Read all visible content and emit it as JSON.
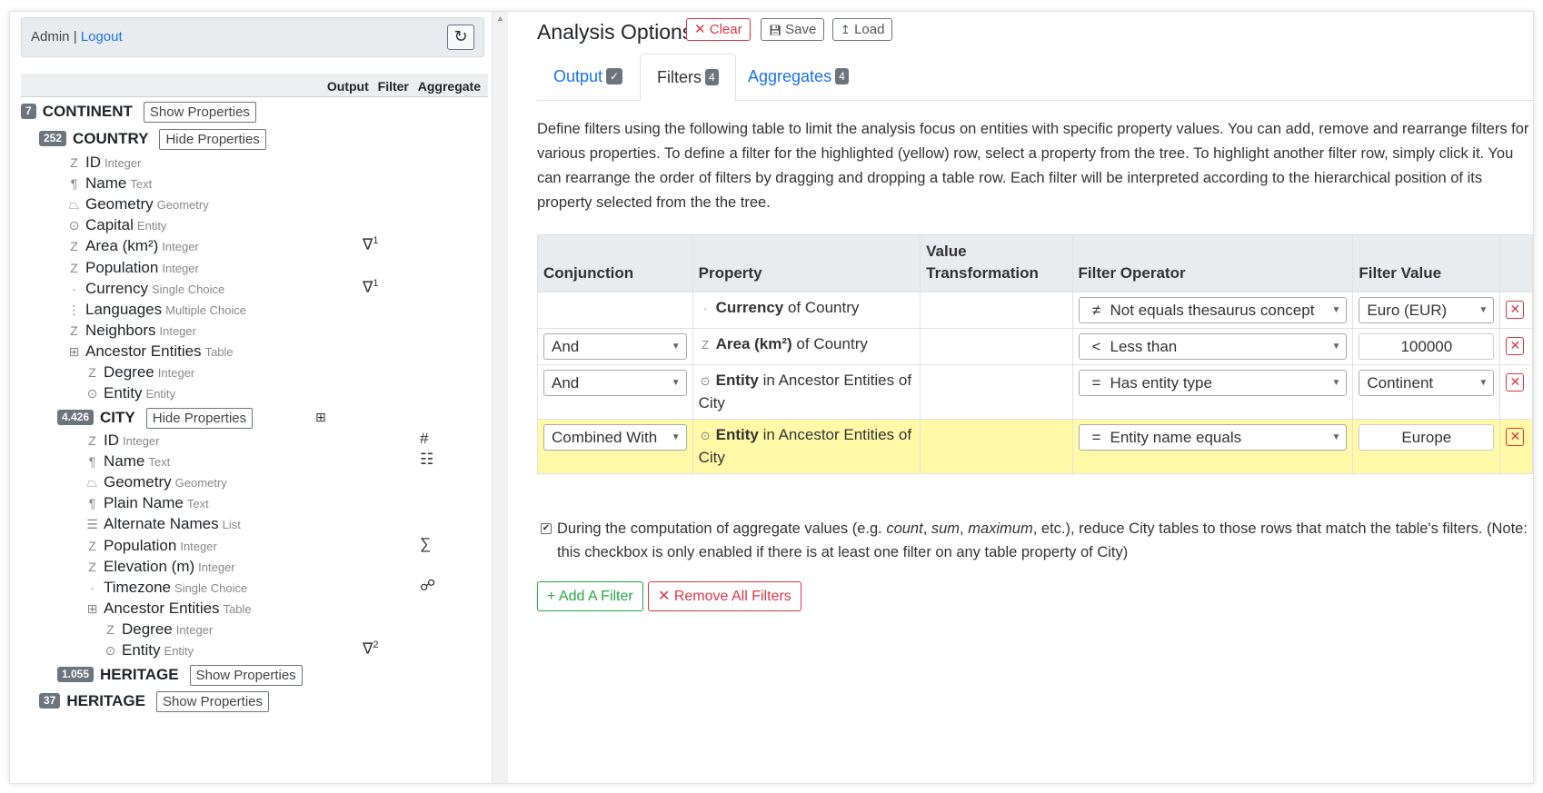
{
  "userbar": {
    "user": "Admin",
    "separator": "|",
    "logout": "Logout",
    "refresh_icon": "refresh-icon"
  },
  "columns": {
    "output": "Output",
    "filter": "Filter",
    "aggregate": "Aggregate"
  },
  "tree": {
    "continent": {
      "count": "7",
      "name": "CONTINENT",
      "button": "Show Properties"
    },
    "country": {
      "count": "252",
      "name": "COUNTRY",
      "button": "Hide Properties"
    },
    "country_props": [
      {
        "icon": "Z",
        "name": "ID",
        "type": "Integer"
      },
      {
        "icon": "¶",
        "name": "Name",
        "type": "Text"
      },
      {
        "icon": "⏢",
        "name": "Geometry",
        "type": "Geometry"
      },
      {
        "icon": "⊙",
        "name": "Capital",
        "type": "Entity"
      },
      {
        "icon": "Z",
        "name": "Area (km²)",
        "type": "Integer",
        "mark": "∇",
        "sup": "1"
      },
      {
        "icon": "Z",
        "name": "Population",
        "type": "Integer"
      },
      {
        "icon": "·",
        "name": "Currency",
        "type": "Single Choice",
        "mark": "∇",
        "sup": "1"
      },
      {
        "icon": "⋮",
        "name": "Languages",
        "type": "Multiple Choice"
      },
      {
        "icon": "Z",
        "name": "Neighbors",
        "type": "Integer"
      },
      {
        "icon": "⊞",
        "name": "Ancestor Entities",
        "type": "Table"
      }
    ],
    "country_ancestor_props": [
      {
        "icon": "Z",
        "name": "Degree",
        "type": "Integer"
      },
      {
        "icon": "⊙",
        "name": "Entity",
        "type": "Entity"
      }
    ],
    "city": {
      "count": "4.426",
      "name": "CITY",
      "button": "Hide Properties",
      "mark": "⊞"
    },
    "city_props": [
      {
        "icon": "Z",
        "name": "ID",
        "type": "Integer",
        "mark": "#"
      },
      {
        "icon": "¶",
        "name": "Name",
        "type": "Text",
        "mark": "☷"
      },
      {
        "icon": "⏢",
        "name": "Geometry",
        "type": "Geometry"
      },
      {
        "icon": "¶",
        "name": "Plain Name",
        "type": "Text"
      },
      {
        "icon": "☰",
        "name": "Alternate Names",
        "type": "List"
      },
      {
        "icon": "Z",
        "name": "Population",
        "type": "Integer",
        "mark": "∑"
      },
      {
        "icon": "Z",
        "name": "Elevation (m)",
        "type": "Integer"
      },
      {
        "icon": "·",
        "name": "Timezone",
        "type": "Single Choice",
        "mark": "☍"
      },
      {
        "icon": "⊞",
        "name": "Ancestor Entities",
        "type": "Table"
      }
    ],
    "city_ancestor_props": [
      {
        "icon": "Z",
        "name": "Degree",
        "type": "Integer"
      },
      {
        "icon": "⊙",
        "name": "Entity",
        "type": "Entity",
        "mark": "∇",
        "sup": "2"
      }
    ],
    "heritage_city": {
      "count": "1.055",
      "name": "HERITAGE",
      "button": "Show Properties"
    },
    "heritage": {
      "count": "37",
      "name": "HERITAGE",
      "button": "Show Properties"
    }
  },
  "main": {
    "title": "Analysis Options",
    "clear": "✕ Clear",
    "save": "Save",
    "load": "Load",
    "tabs": [
      {
        "label": "Output",
        "count": "✓"
      },
      {
        "label": "Filters",
        "count": "4"
      },
      {
        "label": "Aggregates",
        "count": "4"
      }
    ],
    "description": "Define filters using the following table to limit the analysis focus on entities with specific property values. You can add, remove and rearrange filters for various properties. To define a filter for the highlighted (yellow) row, select a property from the tree. To highlight another filter row, simply click it. You can rearrange the order of filters by dragging and dropping a table row. Each filter will be interpreted according to the hierarchical position of its property selected from the the tree.",
    "table": {
      "headers": [
        "Conjunction",
        "Property",
        "Value Transformation",
        "Filter Operator",
        "Filter Value"
      ],
      "rows": [
        {
          "conj": "",
          "picon": "·",
          "pbold": "Currency",
          "prest": " of Country",
          "op": "≠",
          "oplabel": "Not equals thesaurus concept",
          "value": "Euro (EUR)",
          "value_is_select": true
        },
        {
          "conj": "And",
          "picon": "Z",
          "pbold": "Area (km²)",
          "prest": " of Country",
          "op": "<",
          "oplabel": "Less than",
          "value": "100000",
          "value_is_select": false
        },
        {
          "conj": "And",
          "picon": "⊙",
          "pbold": "Entity",
          "prest": " in Ancestor Entities of City",
          "op": "=",
          "oplabel": "Has entity type",
          "value": "Continent",
          "value_is_select": true
        },
        {
          "conj": "Combined With",
          "picon": "⊙",
          "pbold": "Entity",
          "prest": " in Ancestor Entities of City",
          "op": "=",
          "oplabel": "Entity name equals",
          "value": "Europe",
          "value_is_select": false,
          "highlighted": true
        }
      ]
    },
    "checkbox_pre": "During the computation of aggregate values (e.g. ",
    "checkbox_count": "count",
    "checkbox_sum": "sum",
    "checkbox_max": "maximum",
    "checkbox_post": ", etc.), reduce City tables to those rows that match the table's filters. (Note: this checkbox is only enabled if there is at least one filter on any table property of City)",
    "add_filter": "+ Add A Filter",
    "remove_filters": "✕ Remove All Filters"
  },
  "colors": {
    "accent": "#1a73e8",
    "danger": "#dc3545",
    "success": "#28a745",
    "highlight": "#fff9a8"
  }
}
